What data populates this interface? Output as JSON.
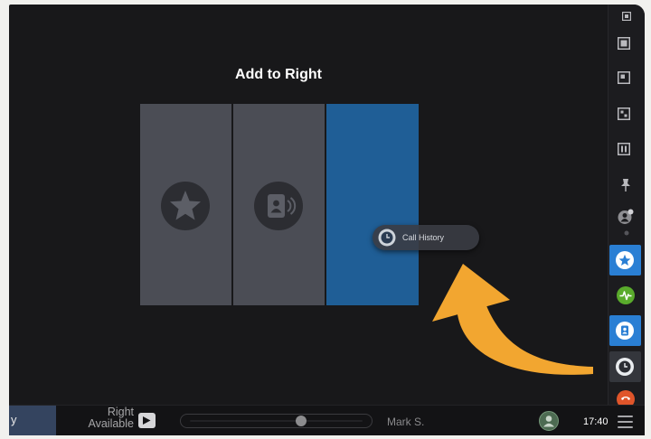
{
  "screen": {
    "title": "Add to Right"
  },
  "tiles": [
    {
      "icon": "star-icon",
      "highlighted": false
    },
    {
      "icon": "directory-icon",
      "highlighted": false
    },
    {
      "highlighted": true
    }
  ],
  "drag_item": {
    "label": "Call History",
    "icon": "call-history-icon"
  },
  "sidebar": {
    "items": [
      {
        "icon": "layout-mini-icon"
      },
      {
        "icon": "layout-full-icon"
      },
      {
        "icon": "layout-overlay-icon"
      },
      {
        "icon": "layout-prominent-icon"
      },
      {
        "icon": "layout-equal-icon"
      },
      {
        "icon": "pin-icon"
      },
      {
        "icon": "selfview-icon"
      },
      {
        "icon": "favorites-icon",
        "active": true
      },
      {
        "icon": "activity-icon"
      },
      {
        "icon": "directory-icon",
        "active": true
      },
      {
        "icon": "call-history-icon",
        "selected": true
      },
      {
        "icon": "phone-icon"
      }
    ]
  },
  "bottom_bar": {
    "left_tab_label": "y",
    "status_line_1": "Right",
    "status_line_2": "Available",
    "slider_level": 0.63,
    "user_name": "Mark S.",
    "time": "17:40"
  },
  "colors": {
    "background": "#18181a",
    "tile_gray": "#4b4d55",
    "tile_blue": "#1f5e96",
    "accent_blue": "#2a7fd4",
    "arrow_orange": "#f2a630",
    "activity_green": "#5aab2c",
    "phone_orange": "#e0552a"
  }
}
